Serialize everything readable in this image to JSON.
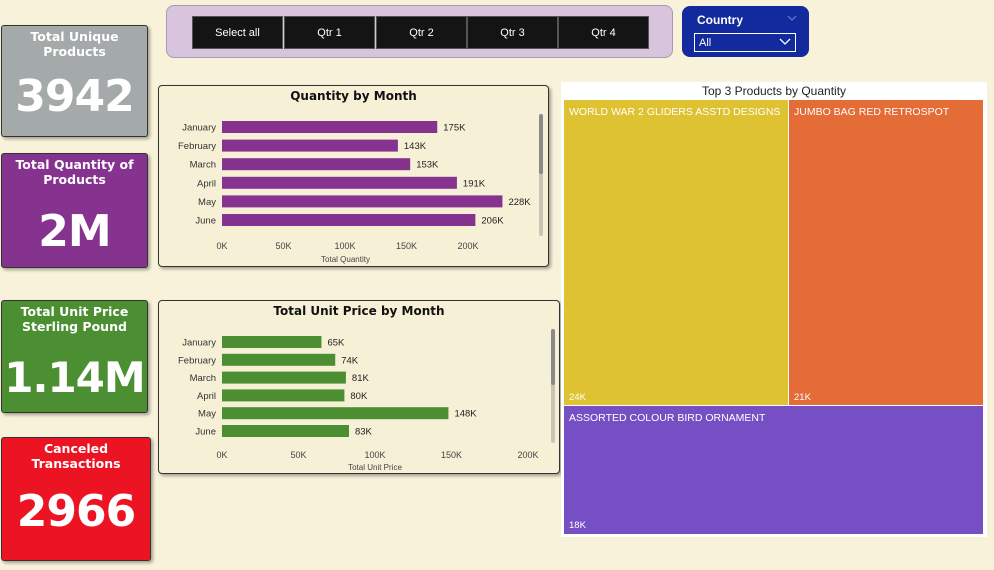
{
  "kpis": [
    {
      "title": "Total Unique Products",
      "value": "3942"
    },
    {
      "title": "Total Quantity of Products",
      "value": "2M"
    },
    {
      "title": "Total Unit Price Sterling Pound",
      "value": "1.14M"
    },
    {
      "title": "Canceled Transactions",
      "value": "2966"
    }
  ],
  "quarter_slicer": {
    "buttons": [
      "Select all",
      "Qtr 1",
      "Qtr 2",
      "Qtr 3",
      "Qtr 4"
    ]
  },
  "country_filter": {
    "title": "Country",
    "selected": "All",
    "chevron_icon": "chevron-down-icon"
  },
  "colors": {
    "qty_bar": "#86338f",
    "price_bar": "#4b8f32",
    "background": "#f8f2da"
  },
  "chart_data": [
    {
      "type": "bar",
      "orientation": "horizontal",
      "title": "Quantity by Month",
      "xlabel": "Total Quantity",
      "ylabel": "",
      "categories": [
        "January",
        "February",
        "March",
        "April",
        "May",
        "June"
      ],
      "values": [
        175000,
        143000,
        153000,
        191000,
        228000,
        206000
      ],
      "data_labels": [
        "175K",
        "143K",
        "153K",
        "191K",
        "228K",
        "206K"
      ],
      "ticks": [
        0,
        50000,
        100000,
        150000,
        200000
      ],
      "tick_labels": [
        "0K",
        "50K",
        "100K",
        "150K",
        "200K"
      ],
      "xlim": [
        0,
        230000
      ]
    },
    {
      "type": "bar",
      "orientation": "horizontal",
      "title": "Total Unit Price by Month",
      "xlabel": "Total Unit Price",
      "ylabel": "",
      "categories": [
        "January",
        "February",
        "March",
        "April",
        "May",
        "June"
      ],
      "values": [
        65000,
        74000,
        81000,
        80000,
        148000,
        83000
      ],
      "data_labels": [
        "65K",
        "74K",
        "81K",
        "80K",
        "148K",
        "83K"
      ],
      "ticks": [
        0,
        50000,
        100000,
        150000,
        200000
      ],
      "tick_labels": [
        "0K",
        "50K",
        "100K",
        "150K",
        "200K"
      ],
      "xlim": [
        0,
        200000
      ]
    },
    {
      "type": "treemap",
      "title": "Top 3 Products by Quantity",
      "items": [
        {
          "label": "WORLD WAR 2 GLIDERS ASSTD DESIGNS",
          "value": 24000,
          "value_label": "24K",
          "color": "#dfc232"
        },
        {
          "label": "JUMBO BAG RED RETROSPOT",
          "value": 21000,
          "value_label": "21K",
          "color": "#e46c37"
        },
        {
          "label": "ASSORTED COLOUR BIRD ORNAMENT",
          "value": 18000,
          "value_label": "18K",
          "color": "#764fc4"
        }
      ]
    }
  ]
}
